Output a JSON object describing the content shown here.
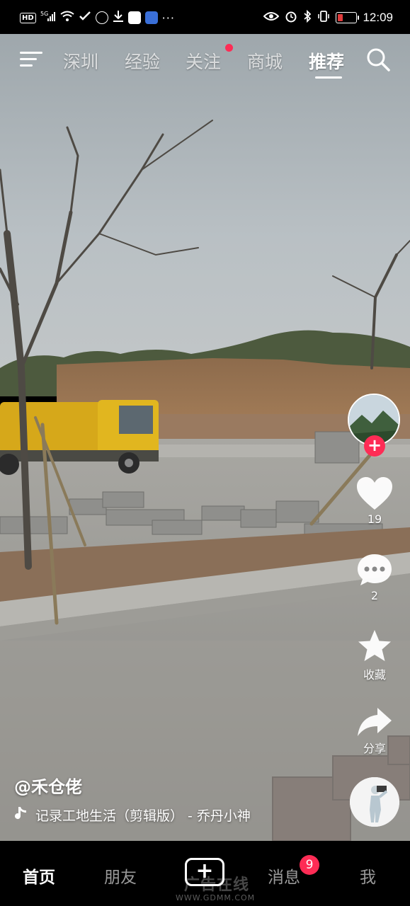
{
  "status_bar": {
    "network_badge": "HD",
    "signal": "5G",
    "time": "12:09",
    "more": "···",
    "icons": [
      "hd-icon",
      "signal-icon",
      "wifi-icon",
      "link-icon",
      "jd-app-icon",
      "download-icon",
      "app-icon",
      "jdm-app-icon",
      "eye-icon",
      "alarm-icon",
      "bluetooth-icon",
      "vibrate-icon",
      "battery-icon"
    ]
  },
  "top_nav": {
    "tabs": [
      {
        "label": "深圳",
        "active": false
      },
      {
        "label": "经验",
        "active": false
      },
      {
        "label": "关注",
        "active": false,
        "has_dot": true
      },
      {
        "label": "商城",
        "active": false
      },
      {
        "label": "推荐",
        "active": true
      }
    ]
  },
  "actions": {
    "like_count": "19",
    "comment_count": "2",
    "favorite_label": "收藏",
    "share_label": "分享",
    "follow_symbol": "+"
  },
  "caption": {
    "author": "@禾仓佬",
    "music": "记录工地生活（剪辑版） - 乔丹小神"
  },
  "bottom_tabs": {
    "home": "首页",
    "friends": "朋友",
    "add": "+",
    "messages": "消息",
    "messages_badge": "9",
    "me": "我"
  },
  "watermark": {
    "brand": "广告在线",
    "url": "WWW.GDMM.COM"
  },
  "colors": {
    "accent": "#fe2c55",
    "battery_low": "#e03b3b",
    "background": "#000000"
  }
}
